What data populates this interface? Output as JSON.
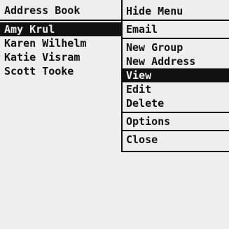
{
  "address_book": {
    "title": "Address Book",
    "contacts": [
      {
        "name": "Amy Krul",
        "selected": true
      },
      {
        "name": "Karen Wilhelm",
        "selected": false
      },
      {
        "name": "Katie Visram",
        "selected": false
      },
      {
        "name": "Scott Tooke",
        "selected": false
      }
    ]
  },
  "menu": {
    "groups": [
      [
        {
          "label": "Hide Menu"
        }
      ],
      [
        {
          "label": "Email"
        }
      ],
      [
        {
          "label": "New Group"
        },
        {
          "label": "New Address"
        },
        {
          "label": "View",
          "selected": true
        },
        {
          "label": "Edit"
        },
        {
          "label": "Delete"
        }
      ],
      [
        {
          "label": "Options"
        }
      ],
      [
        {
          "label": "Close"
        }
      ]
    ]
  },
  "colors": {
    "background": "#eeeeee",
    "foreground": "#111111",
    "highlight": "#111111"
  }
}
